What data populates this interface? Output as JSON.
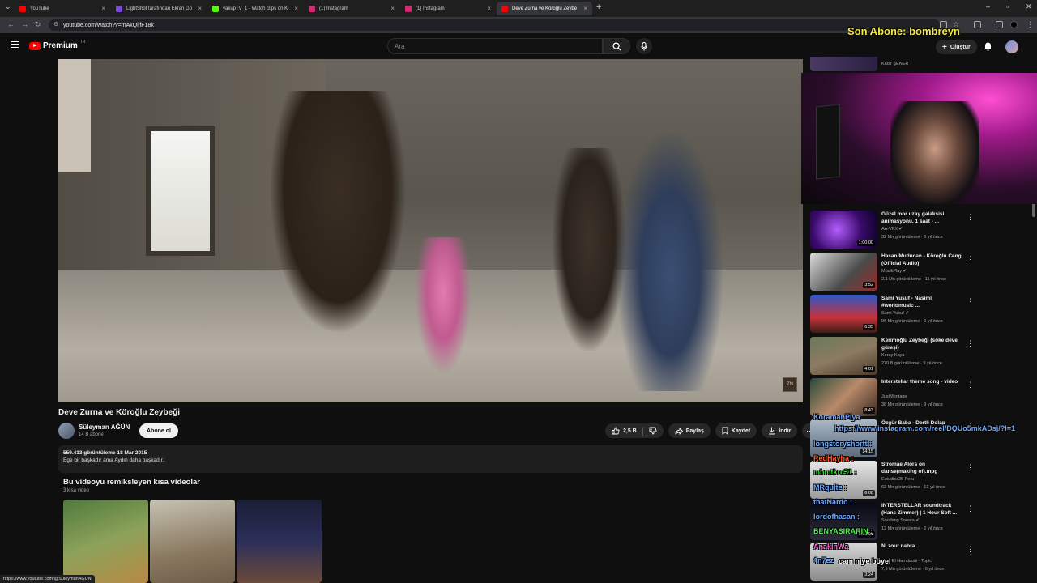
{
  "browser": {
    "tabs": [
      {
        "title": "YouTube",
        "color": "#ff0000"
      },
      {
        "title": "LightShot tarafından Ekran Gö",
        "color": "#7a4ad8"
      },
      {
        "title": "yakupTV_1 - Watch clips on Ki",
        "color": "#53fc18"
      },
      {
        "title": "(1) Instagram",
        "color": "#d62976"
      },
      {
        "title": "(1) Instagram",
        "color": "#d62976"
      },
      {
        "title": "Deve Zurna ve Köroğlu Zeybe",
        "color": "#ff0000",
        "active": true
      }
    ],
    "url": "youtube.com/watch?v=mAkQljfF18k",
    "status_url": "https://www.youtube.com/@SuleymanAGUN"
  },
  "header": {
    "logo": "Premium",
    "logo_sup": "TR",
    "search_placeholder": "Ara",
    "create_label": "Oluştur"
  },
  "overlay": {
    "last_sub": "Son Abone: bombreyn"
  },
  "video": {
    "title": "Deve Zurna ve Köroğlu Zeybeği",
    "channel": "Süleyman AĞÜN",
    "subscribers": "14 B abone",
    "subscribe_label": "Abone ol",
    "likes": "2,5 B",
    "share_label": "Paylaş",
    "save_label": "Kaydet",
    "download_label": "İndir",
    "views_date": "559.413 görüntüleme  18 Mar 2015",
    "description": "Ege bir başkadır ama Aydın daha başkadır..",
    "watermark": "ZN"
  },
  "remix": {
    "title": "Bu videoyu remiksleyen kısa videolar",
    "count": "3 kısa video"
  },
  "top_partial": {
    "channel": "Kadir ŞENER"
  },
  "recommendations": [
    {
      "title": "Güzel mor uzay galaksisi\nanimasyonu. 1 saat - ...",
      "channel": "AA-VFX",
      "meta": "32 Mn görüntüleme · 5 yıl önce",
      "duration": "1:00:00",
      "verified": true
    },
    {
      "title": "Hasan Mutlucan - Köroğlu Cengi\n(Official Audio)",
      "channel": "MüzikPlay",
      "meta": "2,1 Mn görüntüleme · 11 yıl önce",
      "duration": "3:52",
      "verified": true
    },
    {
      "title": "Sami Yusuf - Nasimi\n#worldmusic ...",
      "channel": "Sami Yusuf",
      "meta": "96 Mn görüntüleme · 6 yıl önce",
      "duration": "6:35",
      "verified": true
    },
    {
      "title": "Kerimoğlu Zeybeği (söke deve\ngüreşi)",
      "channel": "Koray Kaya",
      "meta": "270 B görüntüleme · 9 yıl önce",
      "duration": "4:01",
      "verified": false
    },
    {
      "title": "Interstellar theme song - video",
      "channel": "JustMontage",
      "meta": "38 Mn görüntüleme · 9 yıl önce",
      "duration": "8:43",
      "verified": false
    },
    {
      "title": "Özgür Baba - Dertli Dolap",
      "channel": "",
      "meta": "",
      "duration": "14:15",
      "verified": false
    },
    {
      "title": "Stromae   Alors on\ndanse(making of).mpg",
      "channel": "Estudios25 Peru",
      "meta": "63 Mn görüntüleme · 13 yıl önce",
      "duration": "6:08",
      "verified": false
    },
    {
      "title": "INTERSTELLAR soundtrack\n(Hans Zimmer) | 1 Hour Soft ...",
      "channel": "Soothing Sonata",
      "meta": "12 Mn görüntüleme · 2 yıl önce",
      "duration": "1:00:01",
      "verified": true
    },
    {
      "title": "N' zour nabra",
      "channel": "Hadj El Hamdaoui - Topic",
      "meta": "7,9 Mn görüntüleme · 6 yıl önce",
      "duration": "3:24",
      "verified": false
    }
  ],
  "chat_overlay": [
    {
      "text": "KoramanPiya",
      "color": "#6fa8ff"
    },
    {
      "text": "https://www.instagram.com/reel/DQUo5mkADsj/?l=1",
      "color": "#6fa8ff"
    },
    {
      "text": "longstoryshortt :",
      "color": "#6fa8ff"
    },
    {
      "text": "RedHayha :",
      "color": "#ff5a2a"
    },
    {
      "text": "mhmtkrc31 :",
      "color": "#3ddc3d"
    },
    {
      "text": "MRquite :",
      "color": "#6fa8ff"
    },
    {
      "text": "thatNardo :",
      "color": "#6fa8ff"
    },
    {
      "text": "lordofhasan :",
      "color": "#6fa8ff"
    },
    {
      "text": "BENYASIRARIN :",
      "color": "#4cf04c"
    },
    {
      "text": "AnakinWa",
      "color": "#ff6ad5"
    },
    {
      "text": "4n7ez",
      "color": "#6fa8ff"
    },
    {
      "text": "cam niye böyel",
      "color": "#ffffff"
    }
  ]
}
